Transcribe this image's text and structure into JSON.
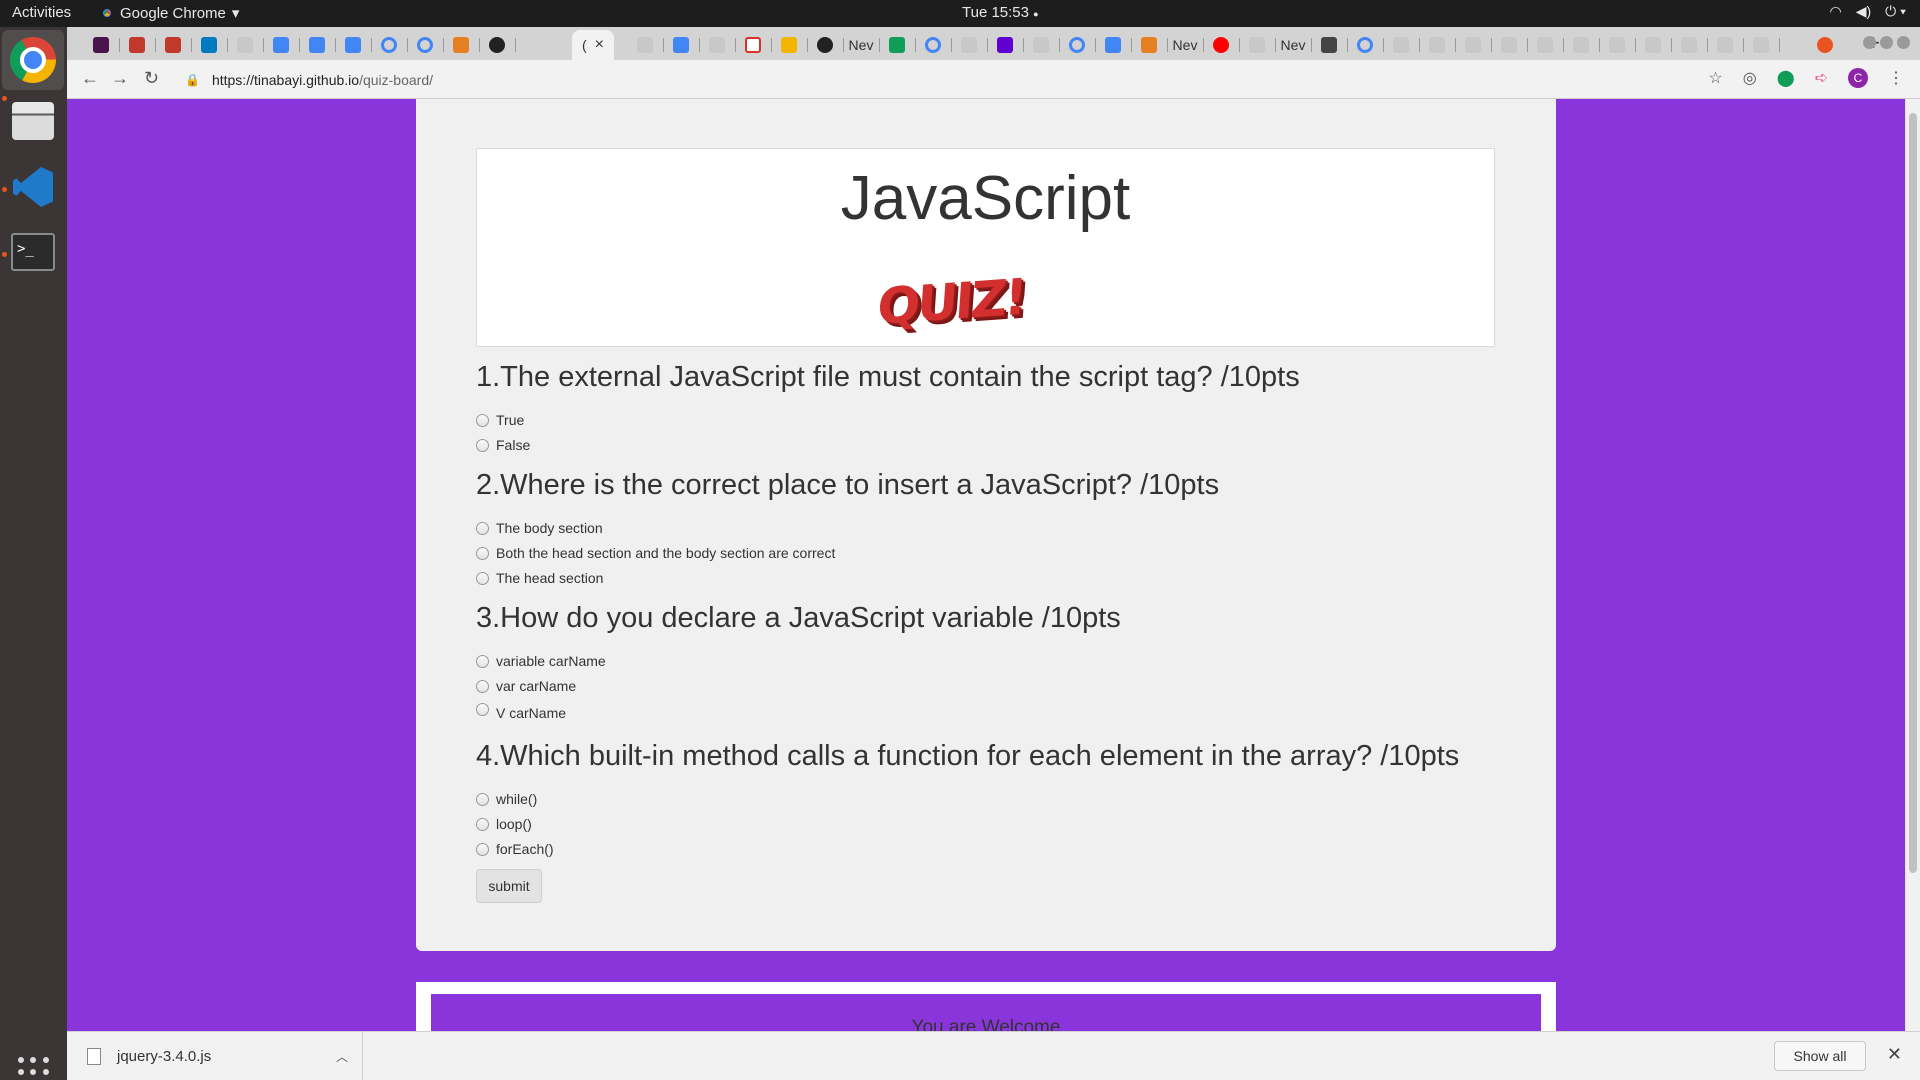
{
  "topbar": {
    "activities": "Activities",
    "app_name": "Google Chrome",
    "app_menu_arrow": "▾",
    "clock": "Tue 15:53",
    "clock_dot": "●"
  },
  "tabs": {
    "active_favicon": "(",
    "active_close": "×",
    "new_labels": [
      "Nev",
      "Nev",
      "Nev"
    ],
    "new_tab": "+"
  },
  "toolbar": {
    "url_host": "https://tinabayi.github.io",
    "url_path": "/quiz-board/"
  },
  "page": {
    "title": "JavaScript",
    "logo_text": "QUIZ!",
    "questions": [
      {
        "text": "1.The external JavaScript file must contain the script tag? /10pts",
        "options": [
          "True",
          "False"
        ]
      },
      {
        "text": "2.Where is the correct place to insert a JavaScript? /10pts",
        "options": [
          "The body section",
          "Both the head section and the body section are correct",
          "The head section"
        ]
      },
      {
        "text": "3.How do you declare a JavaScript variable /10pts",
        "options": [
          "variable carName",
          "var carName",
          "V carName"
        ]
      },
      {
        "text": "4.Which built-in method calls a function for each element in the array? /10pts",
        "options": [
          "while()",
          "loop()",
          "forEach()"
        ]
      }
    ],
    "submit_label": "submit",
    "footer_text": "You are Welcome"
  },
  "downloads": {
    "file_name": "jquery-3.4.0.js",
    "show_all": "Show all",
    "close": "✕"
  },
  "colors": {
    "page_background": "#8a35db",
    "card_background": "#f0f0f0"
  }
}
